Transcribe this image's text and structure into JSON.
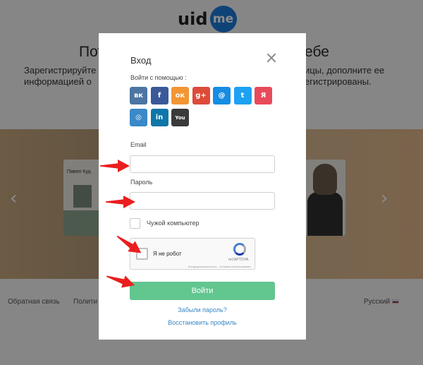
{
  "background": {
    "logo": {
      "uid": "uid",
      "me": "me"
    },
    "title_left": "Пот",
    "title_right": "ебе",
    "subtitle_left": [
      "Зарегистрируйте",
      "информацией о"
    ],
    "subtitle_right": [
      "ицы, дополните ее",
      "егистрированы."
    ],
    "card_left_name": "Павел Куд",
    "footer": {
      "feedback": "Обратная связь",
      "policy": "Полити",
      "language": "Русский"
    }
  },
  "modal": {
    "title": "Вход",
    "social_label": "Войти с помощью :",
    "social": [
      {
        "icon": "vk-icon",
        "glyph": "вк",
        "color": "#4c75a3"
      },
      {
        "icon": "facebook-icon",
        "glyph": "f",
        "color": "#3b5998"
      },
      {
        "icon": "odnoklassniki-icon",
        "glyph": "ок",
        "color": "#f29634"
      },
      {
        "icon": "google-plus-icon",
        "glyph": "g+",
        "color": "#dd4b39"
      },
      {
        "icon": "mailru-icon",
        "glyph": "@",
        "color": "#168de2"
      },
      {
        "icon": "twitter-icon",
        "glyph": "t",
        "color": "#1da1f2"
      },
      {
        "icon": "yandex-icon",
        "glyph": "Я",
        "color": "#e84a5a"
      },
      {
        "icon": "instagram-icon",
        "glyph": "◎",
        "color": "#3a89c9"
      },
      {
        "icon": "linkedin-icon",
        "glyph": "in",
        "color": "#0e76a8"
      },
      {
        "icon": "youtube-icon",
        "glyph": "You",
        "color": "#3a3a3a"
      }
    ],
    "email_label": "Email",
    "email_value": "",
    "password_label": "Пароль",
    "password_value": "",
    "remember_label": "Чужой компьютер",
    "captcha": {
      "text": "Я не робот",
      "brand": "reCAPTCHA",
      "terms": "Конфиденциальность - Условия использования"
    },
    "submit_label": "Войти",
    "forgot_link": "Забыли пароль?",
    "restore_link": "Восстановить профиль"
  },
  "colors": {
    "accent_green": "#62c68f",
    "link_blue": "#3787c5",
    "annotation_red": "#ea1e1e"
  }
}
